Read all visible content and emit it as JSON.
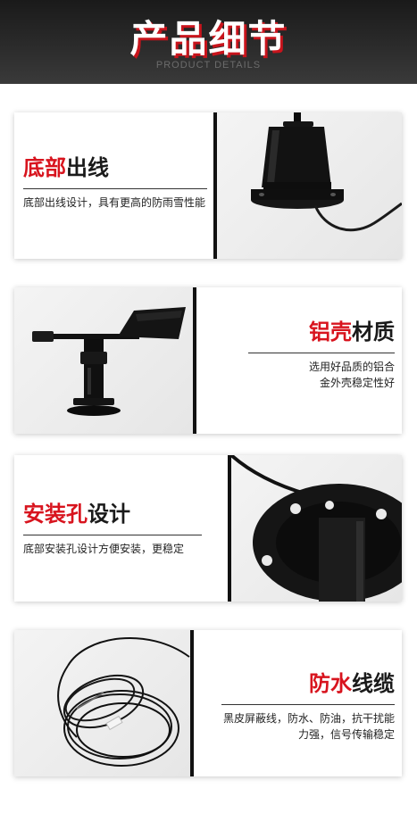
{
  "header": {
    "title": "产品细节",
    "subtitle": "PRODUCT DETAILS"
  },
  "sections": [
    {
      "title_highlight": "底部",
      "title_rest": "出线",
      "description": "底部出线设计，具有更高的防雨雪性能",
      "image": "sensor-bottom-cable-photo"
    },
    {
      "title_highlight": "铝壳",
      "title_rest": "材质",
      "description": "选用好品质的铝合金外壳稳定性好",
      "image": "wind-vane-photo"
    },
    {
      "title_highlight": "安装孔",
      "title_rest": "设计",
      "description": "底部安装孔设计方便安装，更稳定",
      "image": "mounting-flange-photo"
    },
    {
      "title_highlight": "防水",
      "title_rest": "线缆",
      "description": "黑皮屏蔽线，防水、防油，抗干扰能力强，信号传输稳定",
      "image": "coiled-cable-photo"
    }
  ],
  "colors": {
    "accent_red": "#d8141e",
    "header_bg": "#222222",
    "divider": "#111111"
  }
}
